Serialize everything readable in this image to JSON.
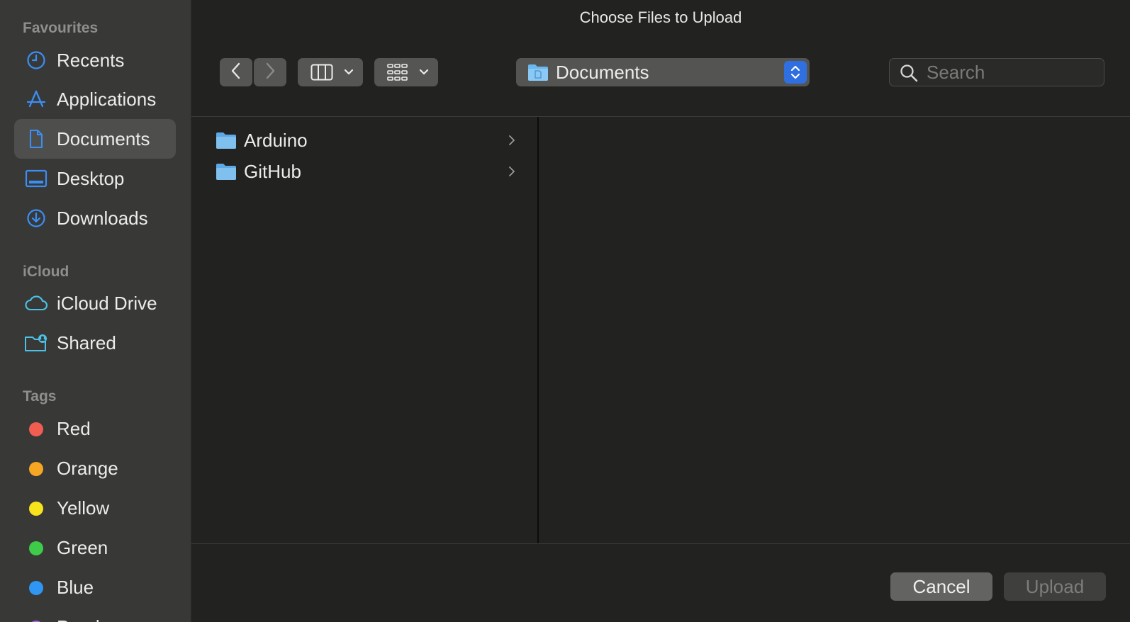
{
  "window": {
    "title": "Choose Files to Upload"
  },
  "sidebar": {
    "favourites_title": "Favourites",
    "favourites": [
      {
        "label": "Recents",
        "icon": "clock-icon"
      },
      {
        "label": "Applications",
        "icon": "applications-icon"
      },
      {
        "label": "Documents",
        "icon": "document-icon",
        "selected": true
      },
      {
        "label": "Desktop",
        "icon": "desktop-icon"
      },
      {
        "label": "Downloads",
        "icon": "download-icon"
      }
    ],
    "icloud_title": "iCloud",
    "icloud": [
      {
        "label": "iCloud Drive",
        "icon": "cloud-icon"
      },
      {
        "label": "Shared",
        "icon": "shared-folder-icon"
      }
    ],
    "tags_title": "Tags",
    "tags": [
      {
        "label": "Red",
        "color": "#f25d52"
      },
      {
        "label": "Orange",
        "color": "#f5a623"
      },
      {
        "label": "Yellow",
        "color": "#f7e21c"
      },
      {
        "label": "Green",
        "color": "#3ecb4a"
      },
      {
        "label": "Blue",
        "color": "#2f96f3"
      },
      {
        "label": "Purple",
        "color": "#b061e0"
      }
    ]
  },
  "toolbar": {
    "location": "Documents",
    "search_placeholder": "Search"
  },
  "files": [
    {
      "name": "Arduino",
      "type": "folder"
    },
    {
      "name": "GitHub",
      "type": "folder"
    }
  ],
  "actions": {
    "cancel": "Cancel",
    "upload": "Upload"
  },
  "colors": {
    "accent": "#2f6fe0",
    "icon_blue": "#3a8ff5",
    "folder_blue": "#6bb7ef"
  }
}
